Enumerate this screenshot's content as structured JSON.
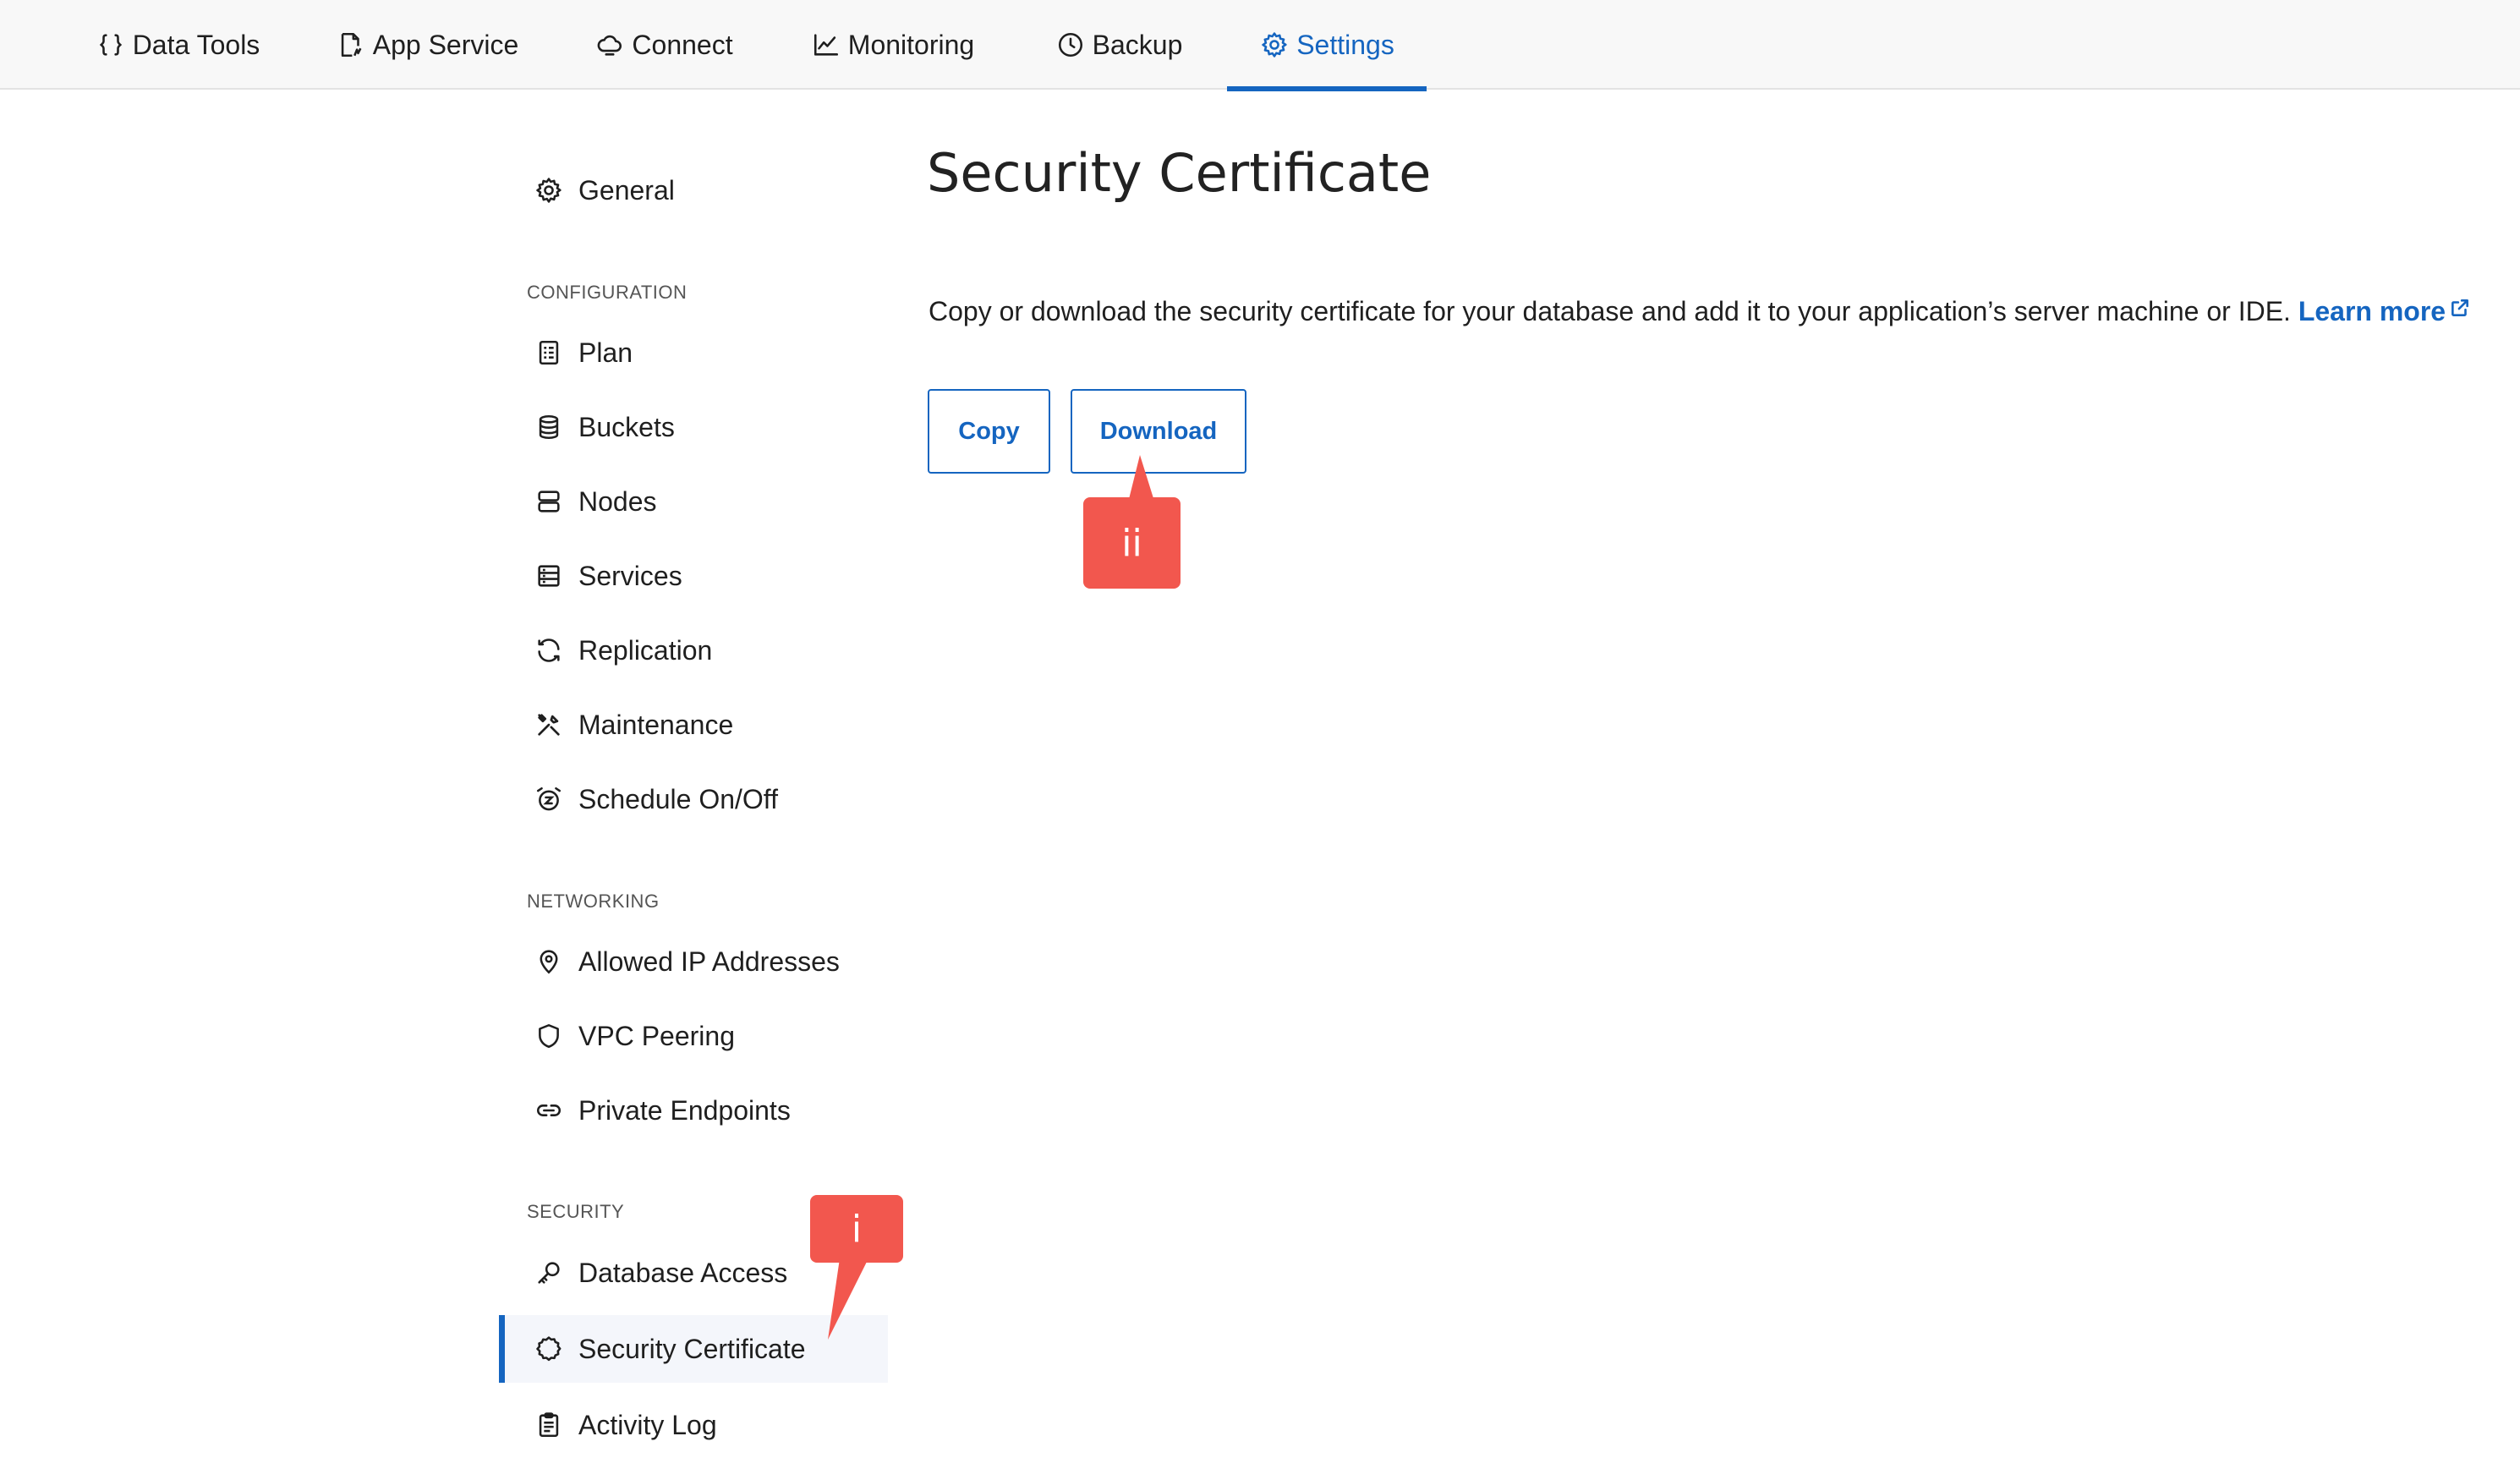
{
  "topnav": {
    "tabs": [
      {
        "label": "Data Tools",
        "icon": "braces-icon"
      },
      {
        "label": "App Service",
        "icon": "app-service-icon"
      },
      {
        "label": "Connect",
        "icon": "cloud-connect-icon"
      },
      {
        "label": "Monitoring",
        "icon": "chart-line-icon"
      },
      {
        "label": "Backup",
        "icon": "clock-icon"
      },
      {
        "label": "Settings",
        "icon": "gear-icon",
        "active": true
      }
    ]
  },
  "sidebar": {
    "general": {
      "label": "General",
      "icon": "gear-icon"
    },
    "configuration": {
      "section_label": "CONFIGURATION",
      "items": [
        {
          "label": "Plan",
          "icon": "plan-icon"
        },
        {
          "label": "Buckets",
          "icon": "database-icon"
        },
        {
          "label": "Nodes",
          "icon": "nodes-icon"
        },
        {
          "label": "Services",
          "icon": "services-icon"
        },
        {
          "label": "Replication",
          "icon": "sync-icon"
        },
        {
          "label": "Maintenance",
          "icon": "tools-icon"
        },
        {
          "label": "Schedule On/Off",
          "icon": "alarm-clock-icon"
        }
      ]
    },
    "networking": {
      "section_label": "NETWORKING",
      "items": [
        {
          "label": "Allowed IP Addresses",
          "icon": "location-pin-icon"
        },
        {
          "label": "VPC Peering",
          "icon": "shield-icon"
        },
        {
          "label": "Private Endpoints",
          "icon": "link-icon"
        }
      ]
    },
    "security": {
      "section_label": "SECURITY",
      "items": [
        {
          "label": "Database Access",
          "icon": "key-icon"
        },
        {
          "label": "Security Certificate",
          "icon": "certificate-icon",
          "active": true
        },
        {
          "label": "Activity Log",
          "icon": "clipboard-icon"
        }
      ]
    }
  },
  "main": {
    "title": "Security Certificate",
    "description": "Copy or download the security certificate for your database and add it to your application’s server machine or IDE.",
    "learn_more": "Learn more",
    "copy_button": "Copy",
    "download_button": "Download"
  },
  "annotations": {
    "callout_i": "i",
    "callout_ii": "ii"
  },
  "colors": {
    "accent": "#1565c0",
    "callout": "#f2574e",
    "active_bg": "#f4f6fb",
    "nav_bg": "#f8f8f8"
  }
}
